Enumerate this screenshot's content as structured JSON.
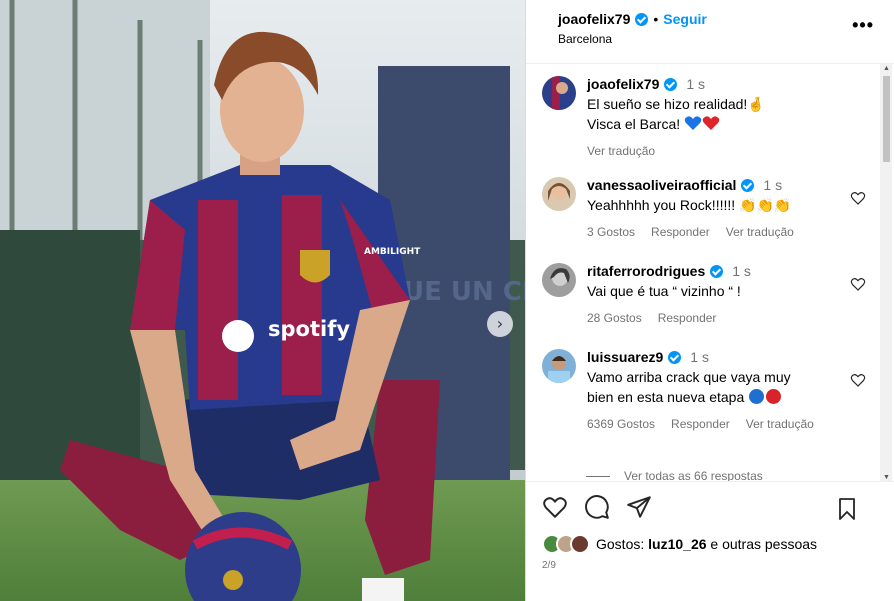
{
  "post": {
    "username": "joaofelix79",
    "location": "Barcelona",
    "follow_label": "Seguir",
    "separator": "•",
    "more_icon": "•••",
    "slide_counter": "2/9"
  },
  "photo": {
    "shirt_text": "AMBILIGHT",
    "sponsor": "spotify",
    "banner_text": "MÉS QUE UN CLUB"
  },
  "caption": {
    "username": "joaofelix79",
    "time": "1 s",
    "line1": "El sueño se hizo realidad!",
    "line1_emoji": "🤞",
    "line2": "Visca el Barca!",
    "translate": "Ver tradução"
  },
  "comments": [
    {
      "username": "vanessaoliveiraofficial",
      "time": "1 s",
      "text": "Yeahhhhh you Rock!!!!!! 👏👏👏",
      "likes": "3 Gostos",
      "reply": "Responder",
      "translate": "Ver tradução"
    },
    {
      "username": "ritaferrorodrigues",
      "time": "1 s",
      "text": "Vai que é tua “ vizinho “ !",
      "likes": "28 Gostos",
      "reply": "Responder"
    },
    {
      "username": "luissuarez9",
      "time": "1 s",
      "text_line1": "Vamo arriba crack que vaya muy",
      "text_line2": "bien en esta nueva etapa",
      "likes": "6369 Gostos",
      "reply": "Responder",
      "translate": "Ver tradução"
    }
  ],
  "view_replies": "Ver todas as 66 respostas",
  "likes_bar": {
    "prefix": "Gostos:",
    "user": "luz10_26",
    "suffix": "e outras pessoas"
  },
  "colors": {
    "accent": "#0095f6",
    "heart_blue": "#1a73e8",
    "heart_red": "#e0242b",
    "muted": "#737373"
  }
}
